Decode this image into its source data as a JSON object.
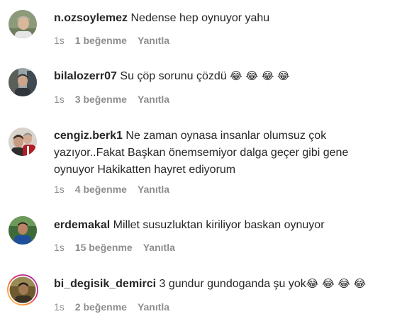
{
  "comments": [
    {
      "username": "n.ozsoylemez",
      "text": "Nedense hep oynuyor yahu",
      "emojis": "",
      "time": "1s",
      "likes": "1 beğenme",
      "reply": "Yanıtla"
    },
    {
      "username": "bilalozerr07",
      "text": "Su çöp sorunu çözdü",
      "emojis": "😂 😂 😂 😂",
      "time": "1s",
      "likes": "3 beğenme",
      "reply": "Yanıtla"
    },
    {
      "username": "cengiz.berk1",
      "text": "Ne zaman oynasa insanlar olumsuz çok yazıyor..Fakat Başkan önemsemiyor dalga geçer gibi gene oynuyor Hakikatten hayret ediyorum",
      "emojis": "",
      "time": "1s",
      "likes": "4 beğenme",
      "reply": "Yanıtla"
    },
    {
      "username": "erdemakal",
      "text": "Millet susuzluktan kiriliyor baskan oynuyor",
      "emojis": "",
      "time": "1s",
      "likes": "15 beğenme",
      "reply": "Yanıtla"
    },
    {
      "username": "bi_degisik_demirci",
      "text": "3 gundur gundoganda şu yok",
      "emojis": "😂 😂 😂 😂",
      "time": "1s",
      "likes": "2 beğenme",
      "reply": "Yanıtla"
    }
  ]
}
